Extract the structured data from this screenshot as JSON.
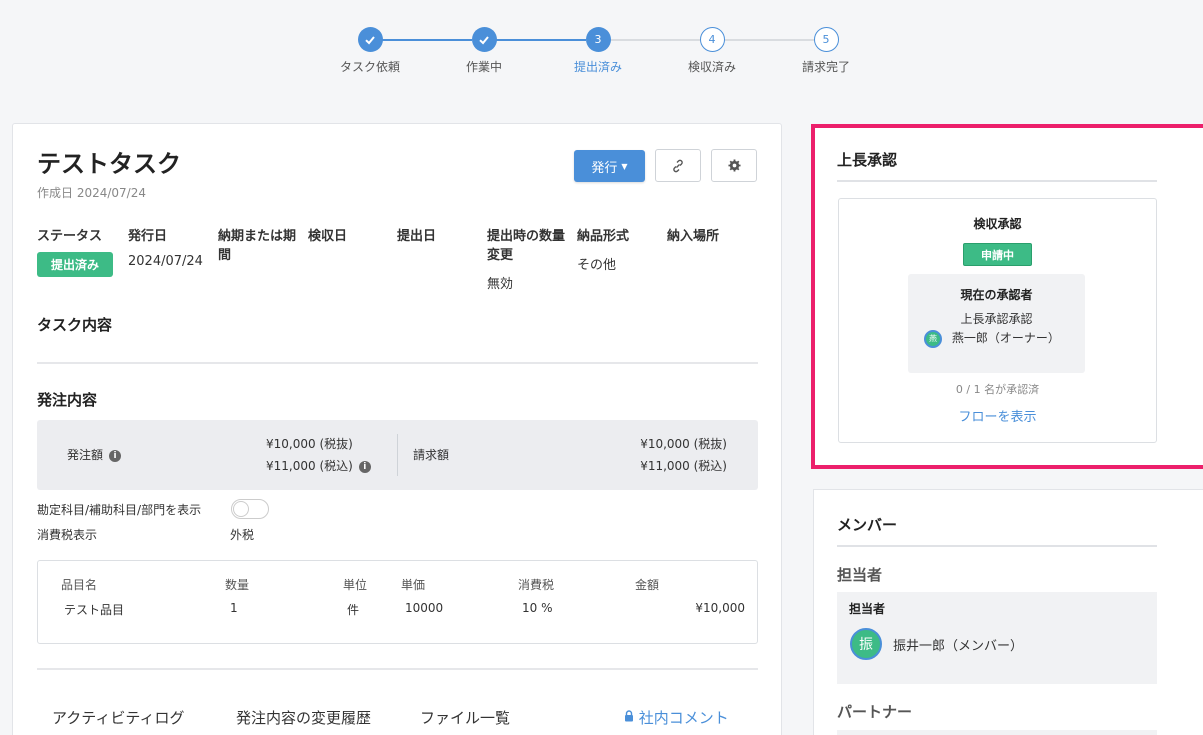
{
  "stepper": {
    "steps": [
      {
        "label": "タスク依頼",
        "number": "1",
        "state": "done"
      },
      {
        "label": "作業中",
        "number": "2",
        "state": "done"
      },
      {
        "label": "提出済み",
        "number": "3",
        "state": "current"
      },
      {
        "label": "検収済み",
        "number": "4",
        "state": "todo"
      },
      {
        "label": "請求完了",
        "number": "5",
        "state": "todo"
      }
    ]
  },
  "task": {
    "title": "テストタスク",
    "created": "作成日 2024/07/24",
    "issue_button": "発行",
    "info": {
      "status_label": "ステータス",
      "status_value": "提出済み",
      "issue_date_label": "発行日",
      "issue_date_value": "2024/07/24",
      "due_label": "納期または期間",
      "inspection_label": "検収日",
      "submit_label": "提出日",
      "qty_change_label": "提出時の数量変更",
      "qty_change_value": "無効",
      "delivery_format_label": "納品形式",
      "delivery_format_value": "その他",
      "delivery_place_label": "納入場所"
    },
    "task_content_title": "タスク内容",
    "order_content_title": "発注内容",
    "order": {
      "order_amount_label": "発注額",
      "order_amount_excl": "¥10,000 (税抜)",
      "order_amount_incl": "¥11,000 (税込)",
      "invoice_label": "請求額",
      "invoice_excl": "¥10,000 (税抜)",
      "invoice_incl": "¥11,000 (税込)"
    },
    "account_toggle_label": "勘定科目/補助科目/部門を表示",
    "tax_display_label": "消費税表示",
    "tax_display_value": "外税",
    "items": {
      "headers": [
        "品目名",
        "数量",
        "単位",
        "単価",
        "消費税",
        "金額"
      ],
      "rows": [
        [
          "テスト品目",
          "1",
          "件",
          "10000",
          "10 %",
          "¥10,000"
        ]
      ]
    },
    "tabs": [
      "アクティビティログ",
      "発注内容の変更履歴",
      "ファイル一覧",
      "社内コメント"
    ]
  },
  "approval": {
    "title": "上長承認",
    "inner_title": "検収承認",
    "status_badge": "申請中",
    "current_approver_label": "現在の承認者",
    "approver_role": "上長承認承認",
    "approver_avatar": "燕",
    "approver_name": "燕一郎（オーナー）",
    "progress": "0 / 1 名が承認済",
    "show_flow_link": "フローを表示"
  },
  "members": {
    "title": "メンバー",
    "assignee_section": "担当者",
    "assignee_box_label": "担当者",
    "assignee_avatar": "振",
    "assignee_name": "振井一郎（メンバー）",
    "partner_section": "パートナー"
  },
  "colors": {
    "accent": "#4a8fd9",
    "success": "#3dbb86",
    "highlight": "#ec1f6b"
  }
}
